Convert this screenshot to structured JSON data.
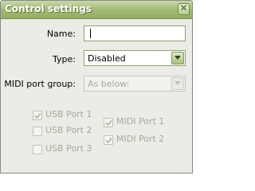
{
  "window": {
    "title": "Control settings",
    "close_symbol": "✕"
  },
  "name_field": {
    "label": "Name:",
    "value": ""
  },
  "type_field": {
    "label": "Type:",
    "value": "Disabled"
  },
  "midi_group_field": {
    "label": "MIDI port group:",
    "value": "As below:"
  },
  "usb_ports": [
    {
      "label": "USB Port 1",
      "checked": true
    },
    {
      "label": "USB Port 2",
      "checked": false
    },
    {
      "label": "USB Port 3",
      "checked": false
    }
  ],
  "midi_ports": [
    {
      "label": "MIDI Port 1",
      "checked": true
    },
    {
      "label": "MIDI Port 2",
      "checked": true
    }
  ],
  "colors": {
    "titlebar": "#9fb96f",
    "window_bg": "#ecebe6",
    "disabled_text": "#a9a89e"
  }
}
